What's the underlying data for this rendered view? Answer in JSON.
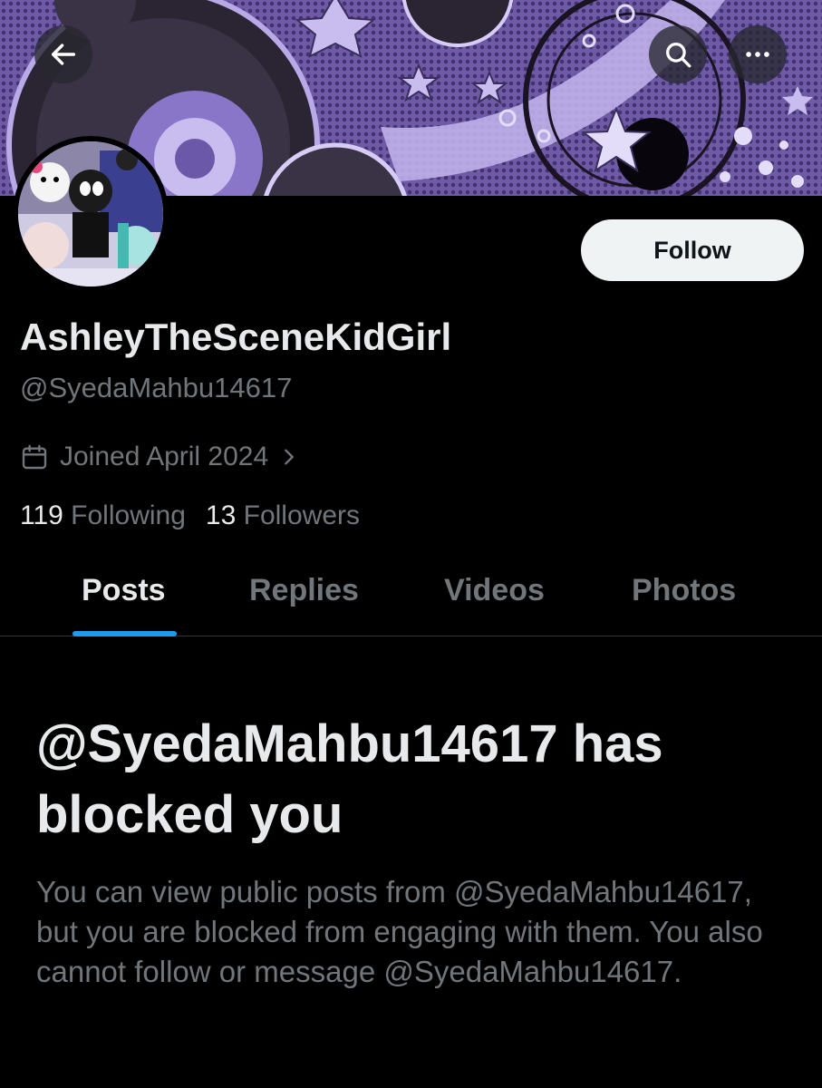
{
  "header": {
    "back_icon": "arrow-left-icon",
    "search_icon": "search-icon",
    "more_icon": "more-horizontal-icon"
  },
  "profile": {
    "display_name": "AshleyTheSceneKidGirl",
    "handle": "@SyedaMahbu14617",
    "joined": "Joined April 2024",
    "joined_icon": "calendar-icon",
    "following_count": "119",
    "following_label": "Following",
    "followers_count": "13",
    "followers_label": "Followers",
    "follow_label": "Follow"
  },
  "tabs": [
    {
      "label": "Posts",
      "active": true
    },
    {
      "label": "Replies",
      "active": false
    },
    {
      "label": "Videos",
      "active": false
    },
    {
      "label": "Photos",
      "active": false
    }
  ],
  "blocked": {
    "title": "@SyedaMahbu14617 has blocked you",
    "body": "You can view public posts from @SyedaMahbu14617, but you are blocked from engaging with them. You also cannot follow or message @SyedaMahbu14617."
  },
  "colors": {
    "background": "#000000",
    "text_primary": "#e7e9ea",
    "text_secondary": "#71767b",
    "accent": "#1d9bf0",
    "banner_purple": "#6f5aa8"
  }
}
